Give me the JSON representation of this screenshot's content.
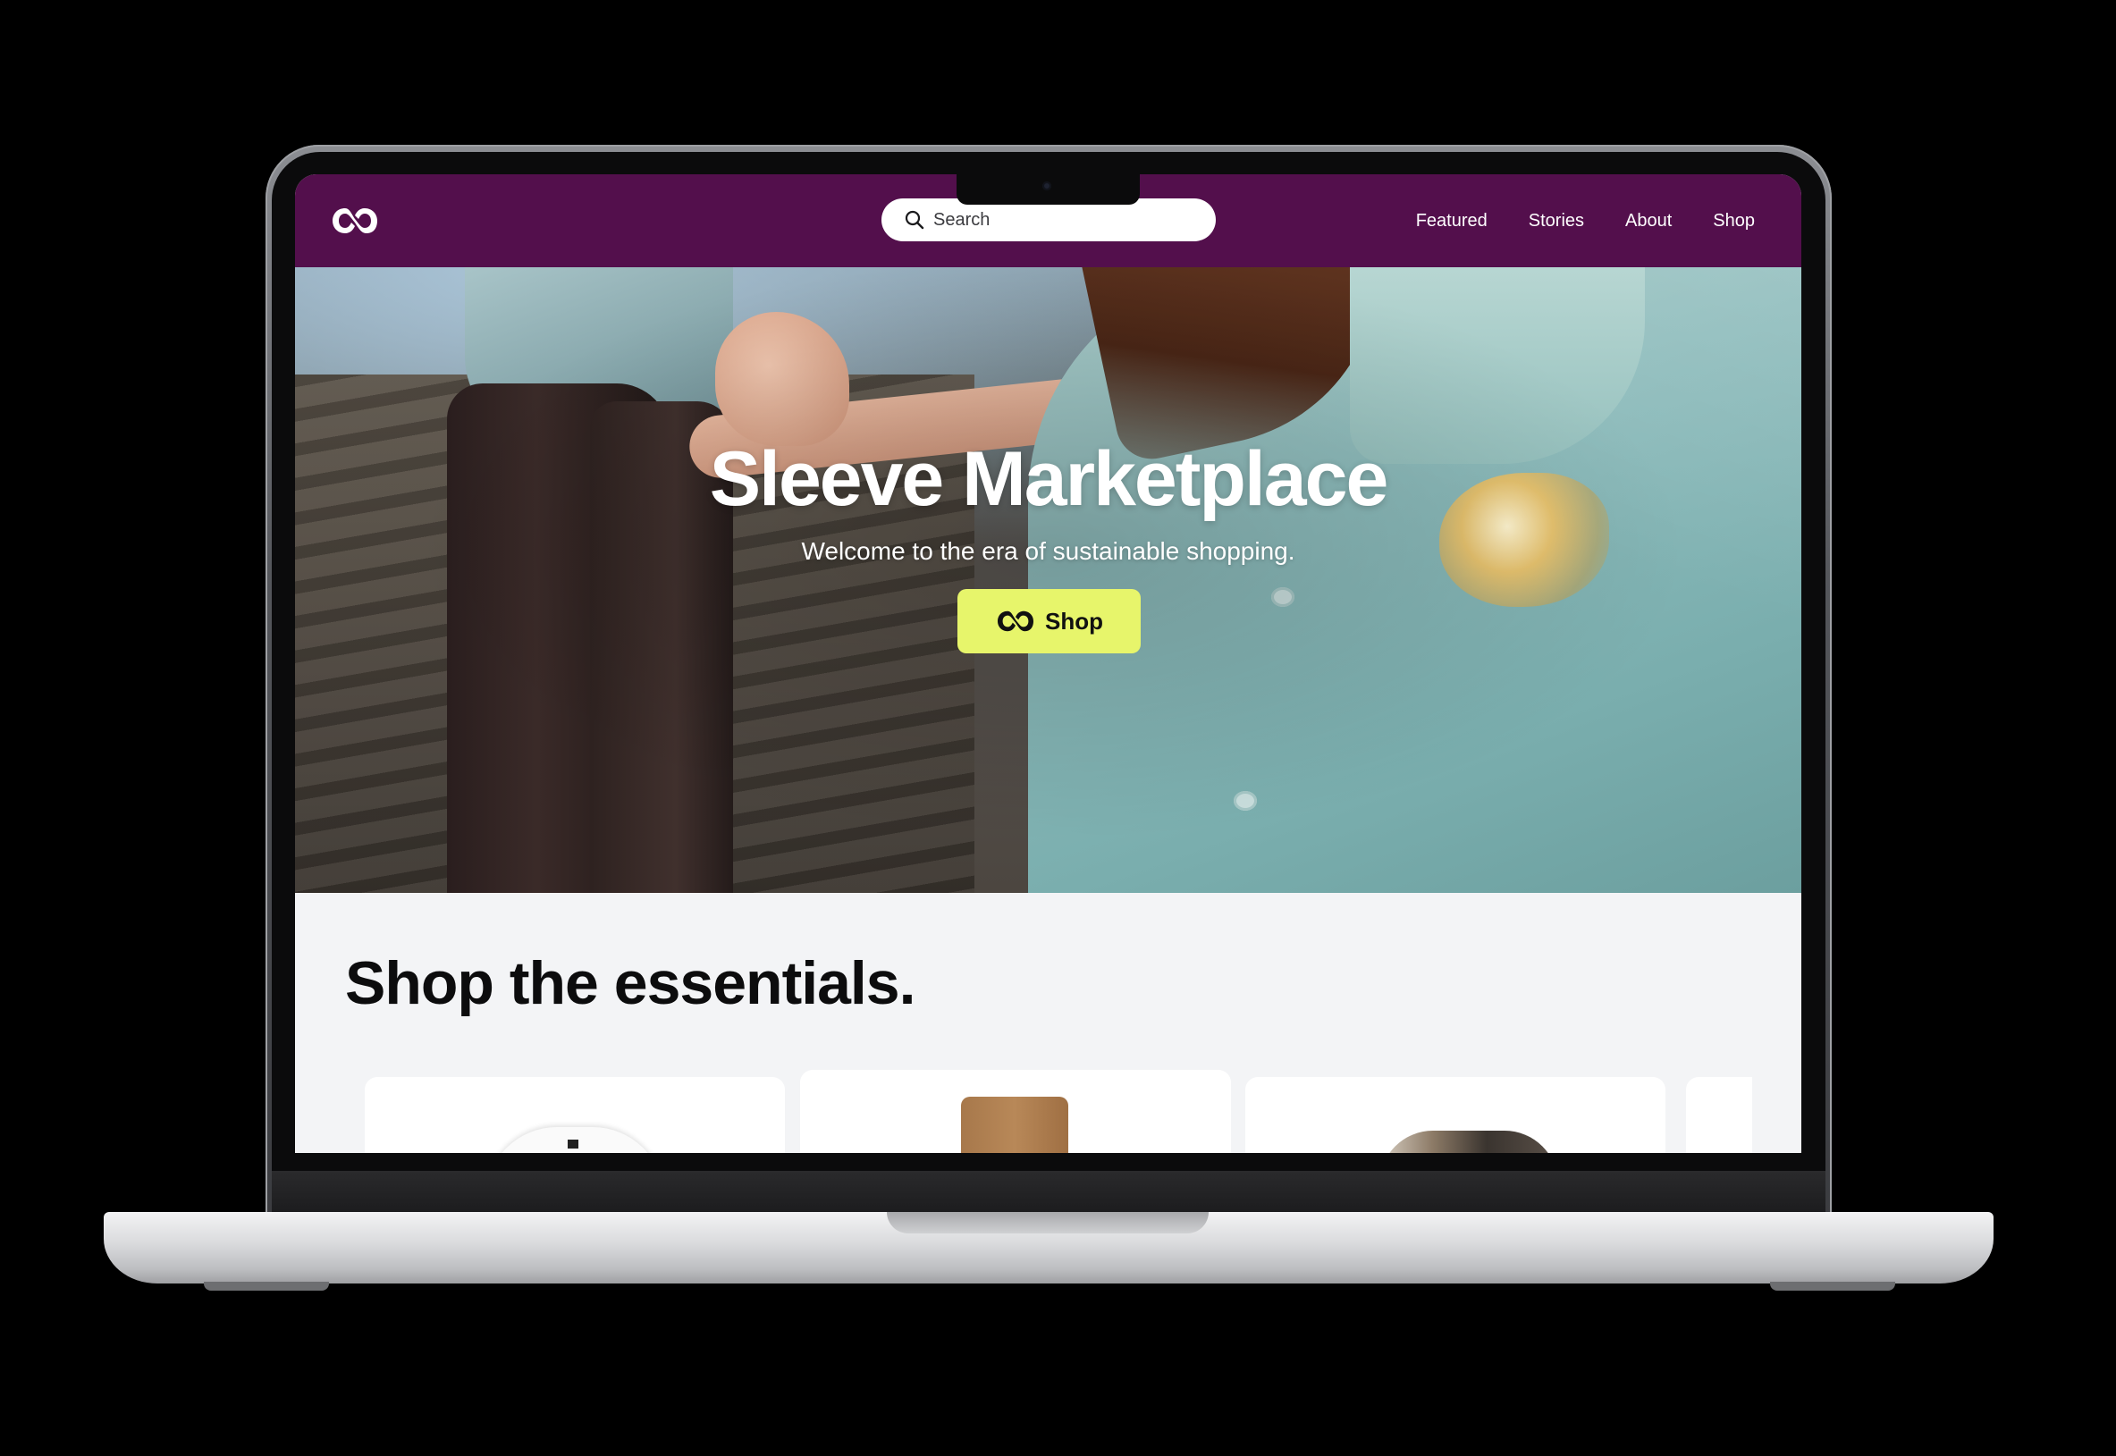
{
  "nav": {
    "logo_icon": "sleeve-logo-icon",
    "search": {
      "placeholder": "Search",
      "icon": "search-icon"
    },
    "links": [
      "Featured",
      "Stories",
      "About",
      "Shop"
    ]
  },
  "hero": {
    "title": "Sleeve Marketplace",
    "subtitle": "Welcome to the era of sustainable shopping.",
    "cta_label": "Shop",
    "cta_icon": "sleeve-logo-icon"
  },
  "essentials": {
    "title": "Shop the essentials.",
    "products": [
      "white-tshirt",
      "tan-chinos",
      "clothing-rack",
      "partial-card"
    ]
  },
  "colors": {
    "brand_purple": "#530f4c",
    "cta_yellow": "#e7f56b",
    "page_background": "#f3f4f6"
  }
}
